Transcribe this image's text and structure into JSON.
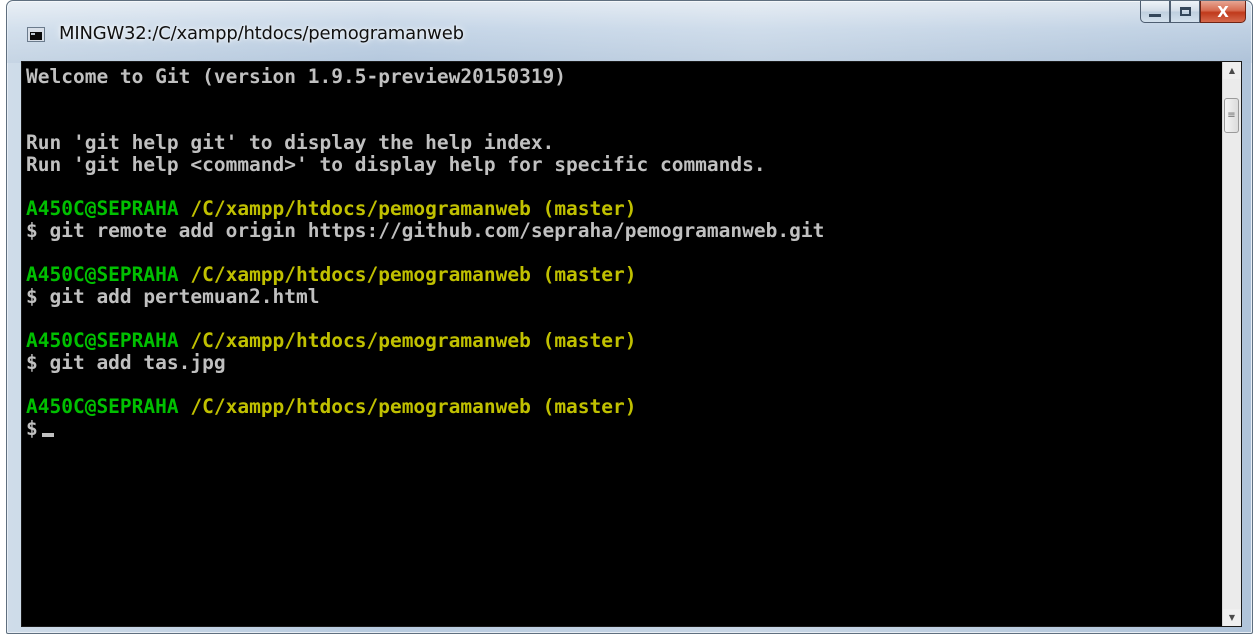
{
  "window": {
    "title": "MINGW32:/C/xampp/htdocs/pemogramanweb",
    "icon": "terminal-icon",
    "buttons": {
      "minimize_icon": "minimize-icon",
      "maximize_icon": "maximize-icon",
      "close_icon": "close-icon",
      "close_glyph": "X"
    }
  },
  "terminal": {
    "welcome": "Welcome to Git (version 1.9.5-preview20150319)",
    "help1": "Run 'git help git' to display the help index.",
    "help2": "Run 'git help <command>' to display help for specific commands.",
    "sessions": [
      {
        "host": "A450C@SEPRAHA",
        "path": "/C/xampp/htdocs/pemogramanweb (master)",
        "command": "$ git remote add origin https://github.com/sepraha/pemogramanweb.git"
      },
      {
        "host": "A450C@SEPRAHA",
        "path": "/C/xampp/htdocs/pemogramanweb (master)",
        "command": "$ git add pertemuan2.html"
      },
      {
        "host": "A450C@SEPRAHA",
        "path": "/C/xampp/htdocs/pemogramanweb (master)",
        "command": "$ git add tas.jpg"
      },
      {
        "host": "A450C@SEPRAHA",
        "path": "/C/xampp/htdocs/pemogramanweb (master)",
        "command": "$"
      }
    ],
    "colors": {
      "background": "#000000",
      "text": "#c0c0c0",
      "host": "#00c000",
      "path": "#c0c000"
    }
  }
}
